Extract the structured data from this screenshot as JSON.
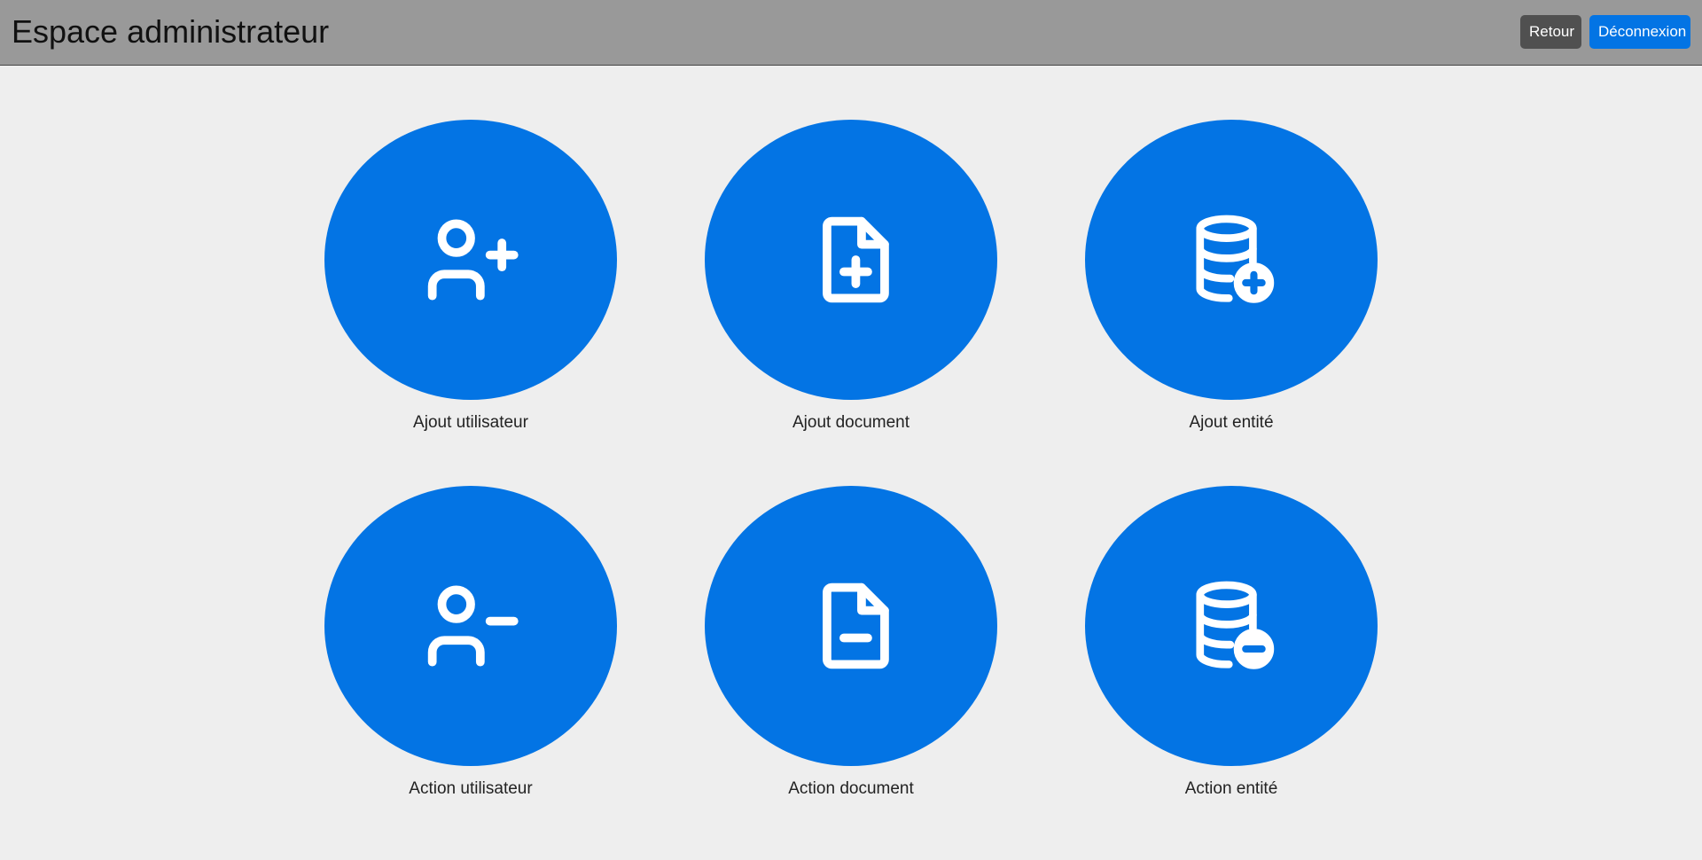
{
  "header": {
    "title": "Espace administrateur",
    "back_label": "Retour",
    "logout_label": "Déconnexion"
  },
  "tiles": [
    {
      "label": "Ajout utilisateur",
      "icon": "user-plus-icon"
    },
    {
      "label": "Ajout document",
      "icon": "file-plus-icon"
    },
    {
      "label": "Ajout entité",
      "icon": "database-plus-icon"
    },
    {
      "label": "Action utilisateur",
      "icon": "user-minus-icon"
    },
    {
      "label": "Action document",
      "icon": "file-minus-icon"
    },
    {
      "label": "Action entité",
      "icon": "database-minus-icon"
    }
  ],
  "colors": {
    "accent": "#0374e4",
    "header_bg": "#999999",
    "page_bg": "#eeeeee",
    "secondary_button": "#505050"
  }
}
